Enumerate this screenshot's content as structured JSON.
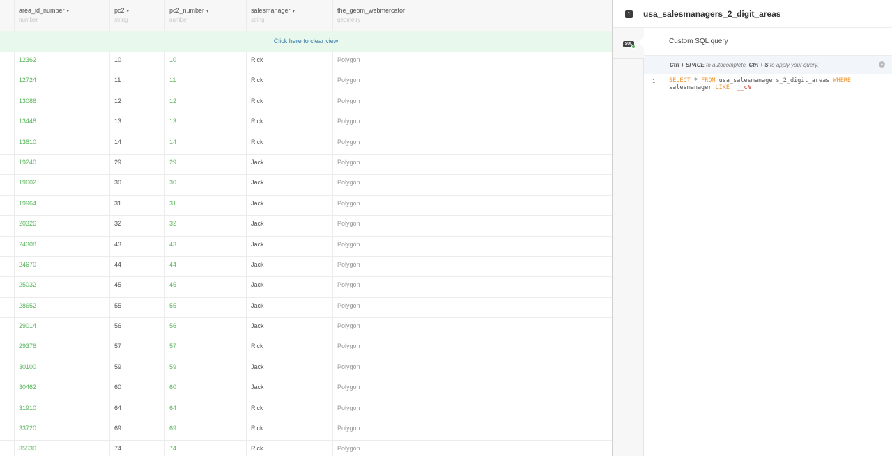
{
  "table": {
    "columns": [
      {
        "name": "area_id_number",
        "type": "number",
        "sortable": true
      },
      {
        "name": "pc2",
        "type": "string",
        "sortable": true
      },
      {
        "name": "pc2_number",
        "type": "number",
        "sortable": true
      },
      {
        "name": "salesmanager",
        "type": "string",
        "sortable": true
      },
      {
        "name": "the_geom_webmercator",
        "type": "geometry",
        "sortable": false
      }
    ],
    "sort_caret": "▾",
    "clear_view_label": "Click here to clear view",
    "rows": [
      [
        "12362",
        "10",
        "10",
        "Rick",
        "Polygon"
      ],
      [
        "12724",
        "11",
        "11",
        "Rick",
        "Polygon"
      ],
      [
        "13086",
        "12",
        "12",
        "Rick",
        "Polygon"
      ],
      [
        "13448",
        "13",
        "13",
        "Rick",
        "Polygon"
      ],
      [
        "13810",
        "14",
        "14",
        "Rick",
        "Polygon"
      ],
      [
        "19240",
        "29",
        "29",
        "Jack",
        "Polygon"
      ],
      [
        "19602",
        "30",
        "30",
        "Jack",
        "Polygon"
      ],
      [
        "19964",
        "31",
        "31",
        "Jack",
        "Polygon"
      ],
      [
        "20326",
        "32",
        "32",
        "Jack",
        "Polygon"
      ],
      [
        "24308",
        "43",
        "43",
        "Jack",
        "Polygon"
      ],
      [
        "24670",
        "44",
        "44",
        "Jack",
        "Polygon"
      ],
      [
        "25032",
        "45",
        "45",
        "Jack",
        "Polygon"
      ],
      [
        "28652",
        "55",
        "55",
        "Jack",
        "Polygon"
      ],
      [
        "29014",
        "56",
        "56",
        "Jack",
        "Polygon"
      ],
      [
        "29376",
        "57",
        "57",
        "Rick",
        "Polygon"
      ],
      [
        "30100",
        "59",
        "59",
        "Jack",
        "Polygon"
      ],
      [
        "30462",
        "60",
        "60",
        "Jack",
        "Polygon"
      ],
      [
        "31910",
        "64",
        "64",
        "Rick",
        "Polygon"
      ],
      [
        "33720",
        "69",
        "69",
        "Rick",
        "Polygon"
      ],
      [
        "35530",
        "74",
        "74",
        "Rick",
        "Polygon"
      ]
    ]
  },
  "panel": {
    "layer_number": "1",
    "layer_name": "usa_salesmanagers_2_digit_areas",
    "sql_icon_label": "SQL",
    "editor_title": "Custom SQL query",
    "hint": {
      "key1": "Ctrl + SPACE",
      "text1": " to autocomplete. ",
      "key2": "Ctrl + S",
      "text2": " to apply your query."
    },
    "close_icon": "×",
    "line_number": "1",
    "query": {
      "kw_select": "SELECT",
      "t1": " * ",
      "kw_from": "FROM",
      "t2": " usa_salesmanagers_2_digit_areas ",
      "kw_where": "WHERE",
      "t3": " salesmanager ",
      "kw_like": "LIKE",
      "t4": " ",
      "str": "'__c%'"
    }
  },
  "colors": {
    "number_green": "#5bb55e",
    "clear_bar_bg": "#e8f8ed",
    "sql_keyword": "#f0952d",
    "sql_string": "#c0392b",
    "hint_bg": "#f2f6fb"
  }
}
